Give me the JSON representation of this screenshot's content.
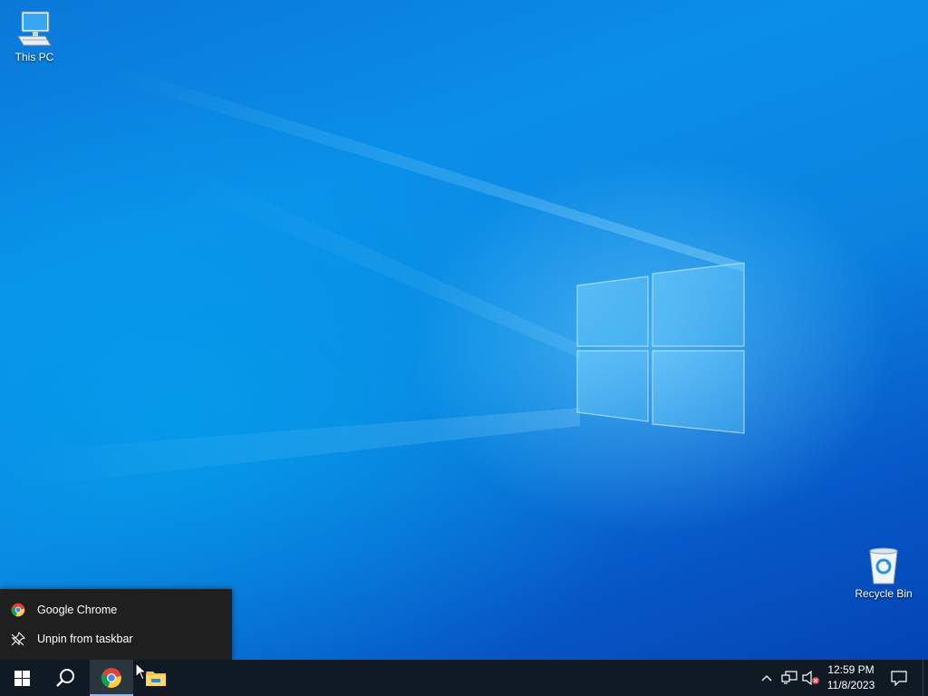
{
  "desktop": {
    "icons": [
      {
        "label": "This PC",
        "icon": "computer-icon"
      },
      {
        "label": "Recycle Bin",
        "icon": "recycle-bin-icon"
      }
    ]
  },
  "jumplist": {
    "items": [
      {
        "label": "Google Chrome",
        "icon": "chrome-icon"
      },
      {
        "label": "Unpin from taskbar",
        "icon": "unpin-icon"
      }
    ]
  },
  "taskbar": {
    "buttons": [
      "start-icon",
      "search-icon",
      "chrome-icon",
      "file-explorer-icon"
    ],
    "tray": {
      "time": "12:59 PM",
      "date": "11/8/2023",
      "icons": [
        "chevron-up-icon",
        "network-icon",
        "volume-muted-icon",
        "notifications-icon"
      ]
    }
  },
  "colors": {
    "taskbar": "#101a24",
    "jumplist": "#1f1f1f",
    "accent": "#0a8ee8"
  }
}
